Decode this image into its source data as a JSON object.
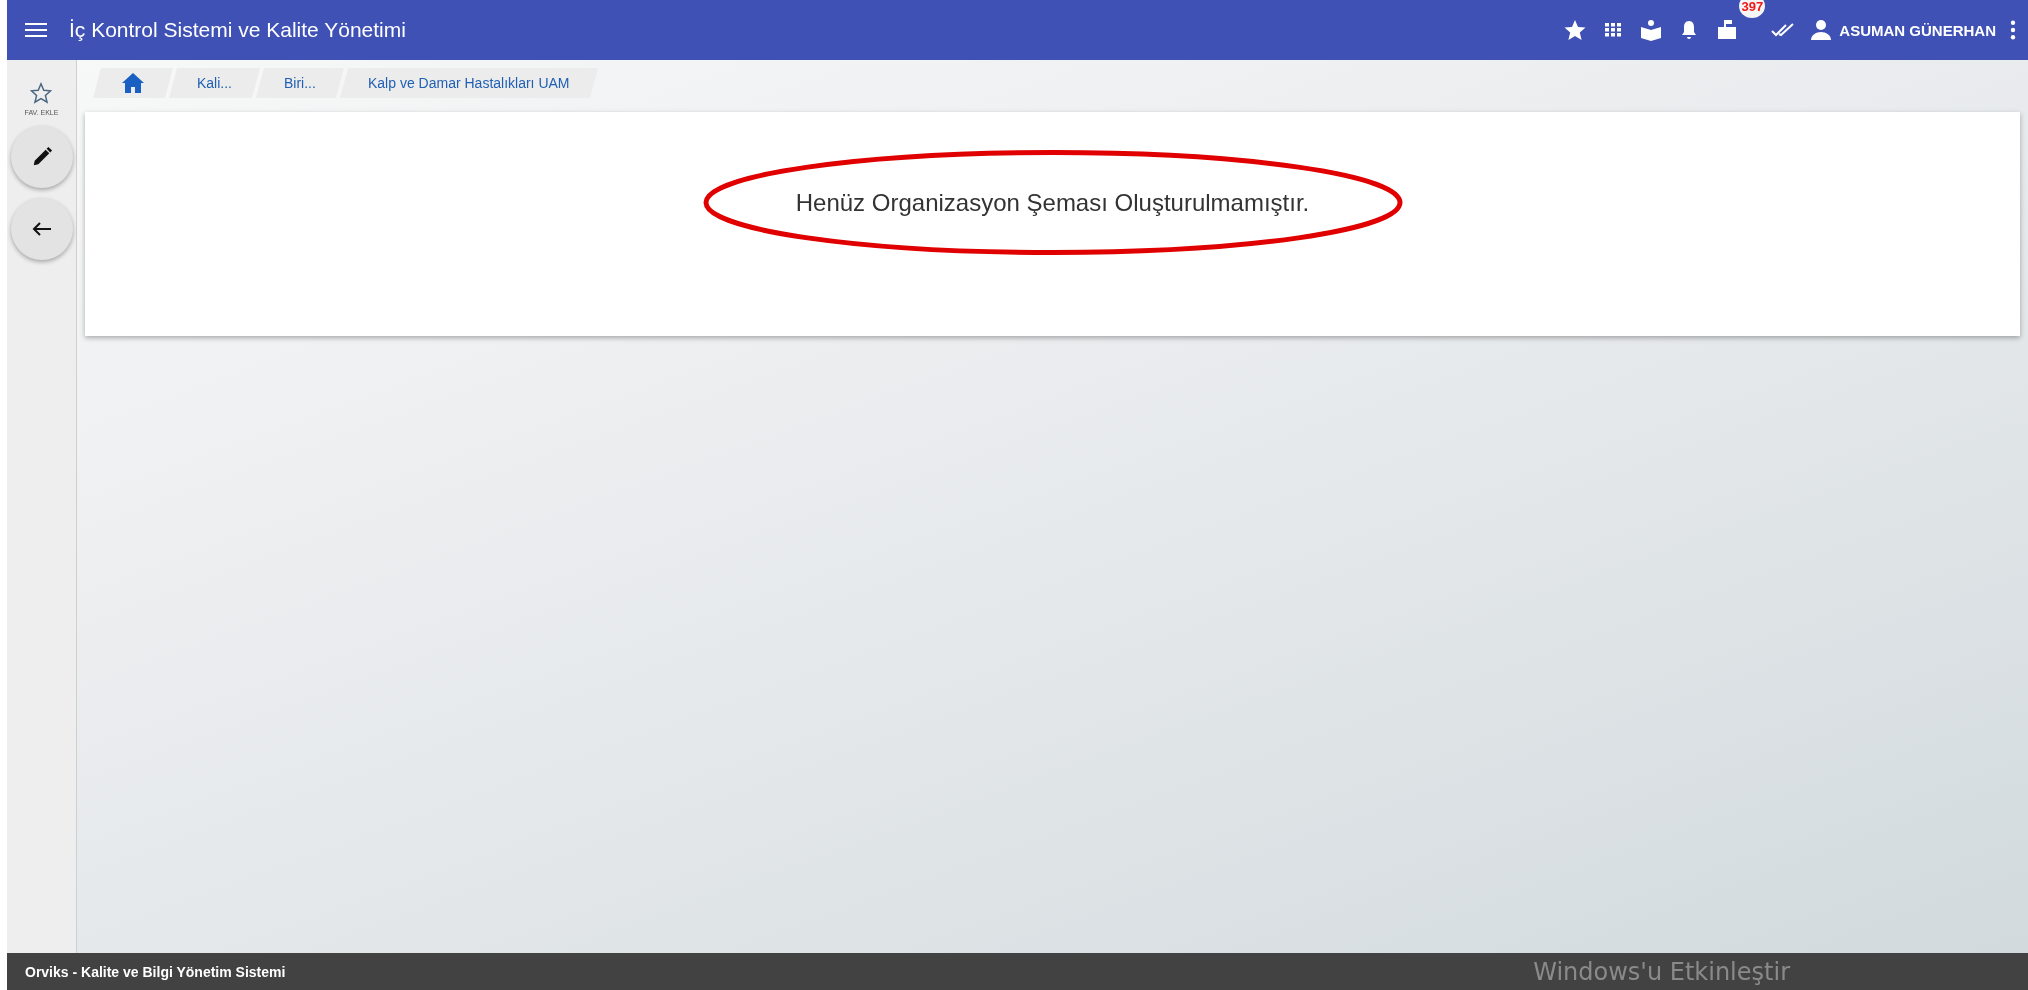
{
  "topbar": {
    "title": "İç Kontrol Sistemi ve Kalite Yönetimi",
    "notification_badge": "397",
    "user_name": "ASUMAN GÜNERHAN"
  },
  "sidebar": {
    "favorite_label": "FAV. EKLE"
  },
  "breadcrumb": [
    {
      "label": "Kali..."
    },
    {
      "label": "Biri..."
    },
    {
      "label": "Kalp ve Damar Hastalıkları UAM"
    }
  ],
  "message": "Henüz Organizasyon Şeması Oluşturulmamıştır.",
  "footer": {
    "text": "Orviks - Kalite ve Bilgi Yönetim Sistemi",
    "os_notice": "Windows'u Etkinleştir"
  }
}
